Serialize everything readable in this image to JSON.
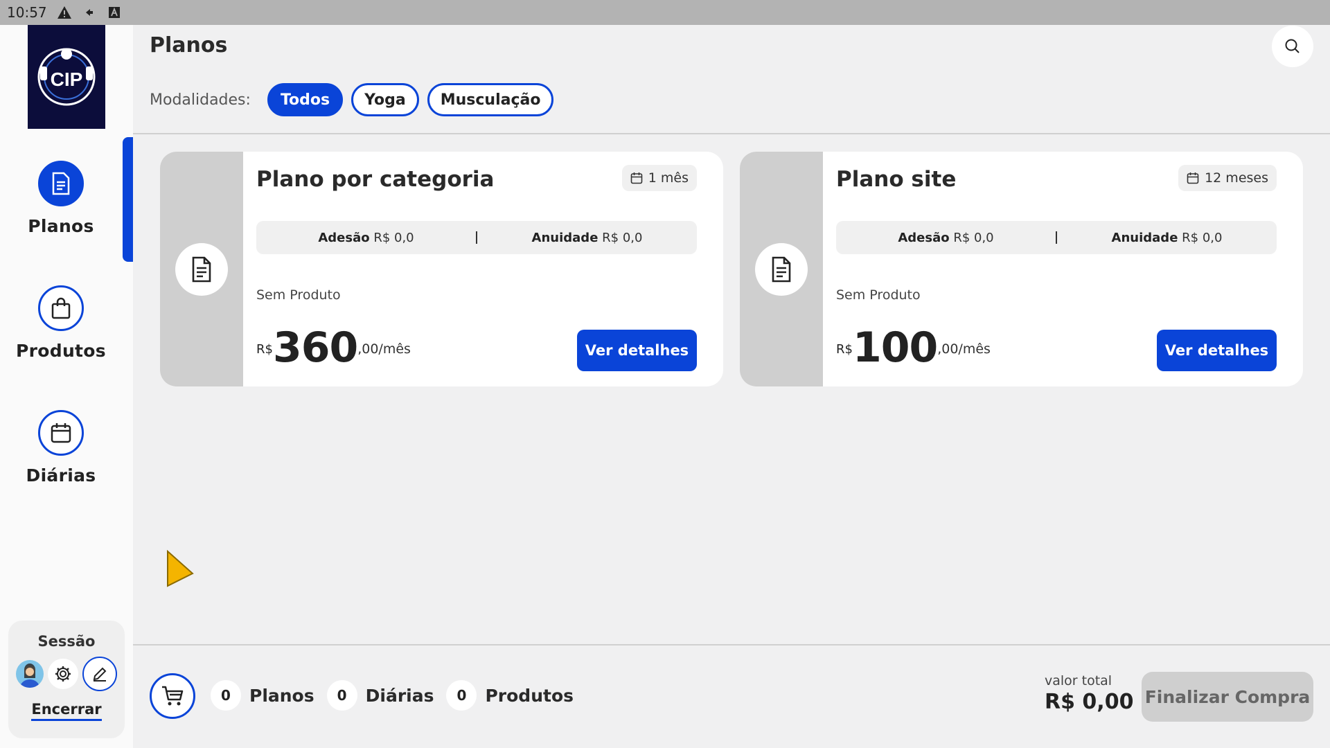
{
  "status_bar": {
    "time": "10:57"
  },
  "sidebar": {
    "logo_text": "CIP",
    "items": [
      {
        "label": "Planos",
        "icon": "document-icon",
        "active": true
      },
      {
        "label": "Produtos",
        "icon": "shopping-bag-icon",
        "active": false
      },
      {
        "label": "Diárias",
        "icon": "calendar-icon",
        "active": false
      }
    ],
    "session": {
      "title": "Sessão",
      "logout_label": "Encerrar"
    }
  },
  "header": {
    "title": "Planos",
    "filters_label": "Modalidades:",
    "filters": [
      {
        "label": "Todos",
        "active": true
      },
      {
        "label": "Yoga",
        "active": false
      },
      {
        "label": "Musculação",
        "active": false
      }
    ]
  },
  "plans": [
    {
      "title": "Plano por categoria",
      "duration": "1 mês",
      "adesao_label": "Adesão",
      "adesao_value": "R$ 0,0",
      "anuidade_label": "Anuidade",
      "anuidade_value": "R$ 0,0",
      "description": "Sem Produto",
      "currency": "R$",
      "price_main": "360",
      "price_suffix": ",00/mês",
      "button": "Ver detalhes"
    },
    {
      "title": "Plano site",
      "duration": "12 meses",
      "adesao_label": "Adesão",
      "adesao_value": "R$ 0,0",
      "anuidade_label": "Anuidade",
      "anuidade_value": "R$ 0,0",
      "description": "Sem Produto",
      "currency": "R$",
      "price_main": "100",
      "price_suffix": ",00/mês",
      "button": "Ver detalhes"
    }
  ],
  "footer": {
    "counts": [
      {
        "value": "0",
        "label": "Planos"
      },
      {
        "value": "0",
        "label": "Diárias"
      },
      {
        "value": "0",
        "label": "Produtos"
      }
    ],
    "total_label": "valor total",
    "total_value": "R$ 0,00",
    "finalize_label": "Finalizar Compra"
  },
  "colors": {
    "accent": "#0a44d8",
    "card_side": "#cfcfcf",
    "background": "#f0f0f1"
  }
}
